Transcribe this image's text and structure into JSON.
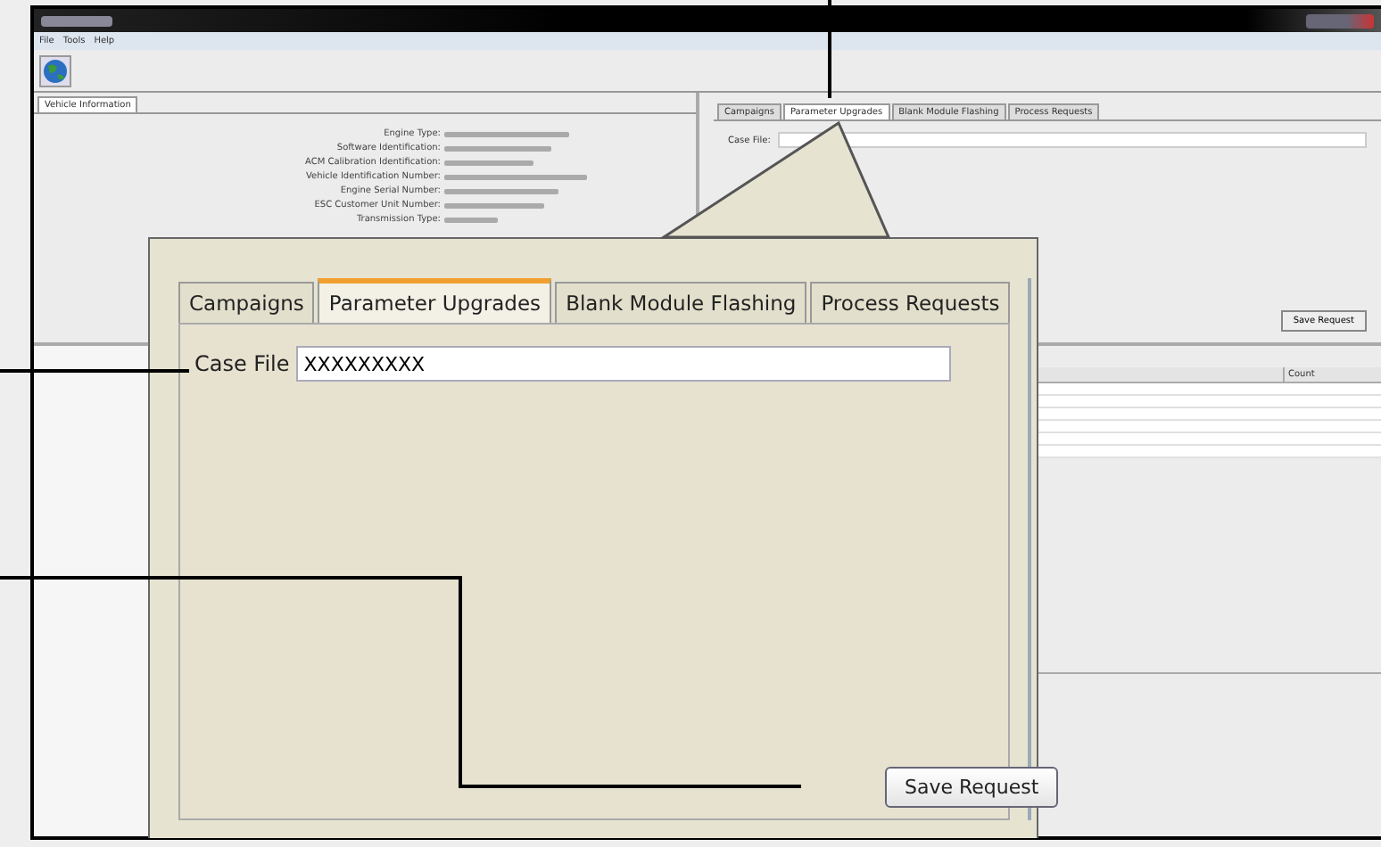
{
  "window": {
    "menu": [
      "File",
      "Tools",
      "Help"
    ]
  },
  "vehicle_panel": {
    "tab": "Vehicle Information",
    "fields": [
      {
        "label": "Engine Type:"
      },
      {
        "label": "Software Identification:"
      },
      {
        "label": "ACM Calibration Identification:"
      },
      {
        "label": "Vehicle Identification Number:"
      },
      {
        "label": "Engine Serial Number:"
      },
      {
        "label": "ESC Customer Unit Number:"
      },
      {
        "label": "Transmission Type:"
      }
    ]
  },
  "request_panel": {
    "tabs": [
      {
        "label": "Campaigns",
        "selected": false
      },
      {
        "label": "Parameter Upgrades",
        "selected": true
      },
      {
        "label": "Blank Module Flashing",
        "selected": false
      },
      {
        "label": "Process Requests",
        "selected": false
      }
    ],
    "case_file_label": "Case File:",
    "save_button": "Save Request"
  },
  "table": {
    "columns": [
      "Count"
    ]
  },
  "callout": {
    "tabs": [
      {
        "label": "Campaigns",
        "selected": false
      },
      {
        "label": "Parameter Upgrades",
        "selected": true
      },
      {
        "label": "Blank Module Flashing",
        "selected": false
      },
      {
        "label": "Process Requests",
        "selected": false
      }
    ],
    "case_file_label": "Case File",
    "case_file_value": "XXXXXXXXX",
    "save_button": "Save Request"
  }
}
